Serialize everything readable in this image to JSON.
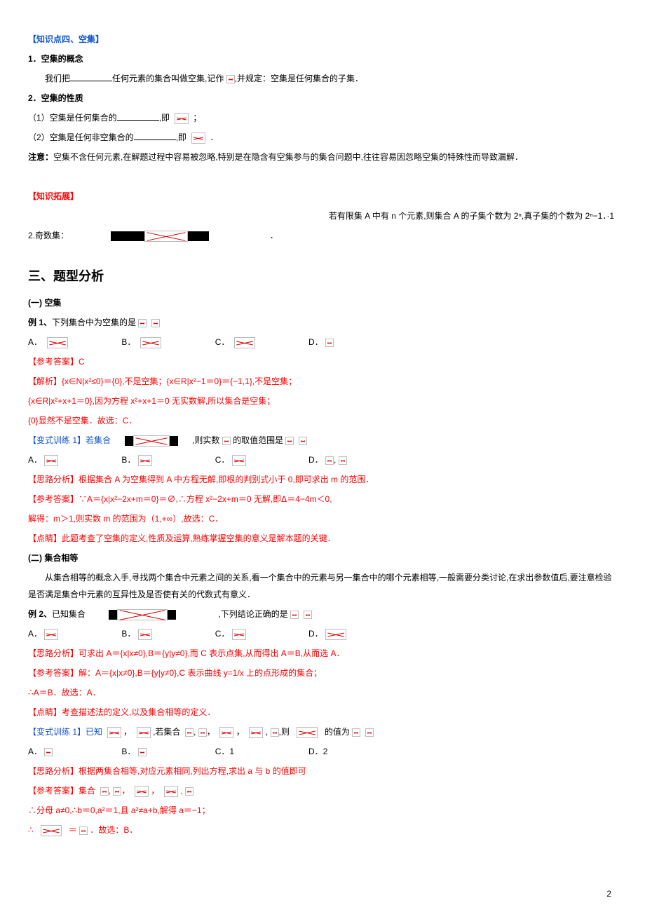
{
  "kp4": {
    "title": "【知识点四、空集】",
    "s1_title": "1．空集的概念",
    "s1_text_pre": "我们把",
    "s1_text_post": "任何元素的集合叫做空集,记作",
    "s1_text_tail": ",并规定：空集是任何集合的子集．",
    "s2_title": "2．空集的性质",
    "s2_p1_pre": "（1）空集是任何集合的",
    "s2_p1_mid": ",即",
    "s2_p1_tail": "；",
    "s2_p2_pre": "（2）空集是任何非空集合的",
    "s2_p2_mid": ",即",
    "s2_p2_tail": "．",
    "note_label": "注意：",
    "note_text": "空集不含任何元素,在解题过程中容易被忽略,特别是在隐含有空集参与的集合问题中,往往容易因忽略空集的特殊性而导致漏解．"
  },
  "ext": {
    "title": "【知识拓展】",
    "line1": "若有限集 A 中有 n 个元素,则集合 A 的子集个数为 2ⁿ,真子集的个数为 2ⁿ−1．·1",
    "line2_pre": "2.奇数集：",
    "line2_tail": "．"
  },
  "sec3": {
    "title": "三、题型分析",
    "p1_title": "(一) 空集",
    "ex1_label": "例 1、",
    "ex1_text": "下列集合中为空集的是",
    "ex1_A": "A．",
    "ex1_B": "B．",
    "ex1_C": "C．",
    "ex1_D": "D．",
    "ans1_h": "【参考答案】C",
    "ans1_l1": "【解析】{x∈N|x²≤0}＝{0},不是空集；{x∈R|x²−1＝0}＝{−1,1},不是空集；",
    "ans1_l2": "{x∈R|x²+x+1＝0},因为方程 x²+x+1＝0 无实数解,所以集合是空集；",
    "ans1_l3": "{0}显然不是空集．故选：C．",
    "var1_pre": "【变式训练 1】若集合",
    "var1_mid": ",则实数",
    "var1_post": "的取值范围是",
    "var1_A": "A．",
    "var1_B": "B．",
    "var1_C": "C．",
    "var1_D": "D．",
    "var1_d_tail": ",",
    "sil1": "【思路分析】根据集合 A 为空集得到 A 中方程无解,即根的判别式小于 0,即可求出 m 的范围．",
    "ref1": "【参考答案】∵A＝{x|x²−2x+m＝0}＝∅,∴方程 x²−2x+m＝0 无解,即Δ＝4−4m＜0,",
    "ref1b": "解得：m＞1,则实数 m 的范围为（1,+∞）,故选：C．",
    "ds1": "【点睛】此题考查了空集的定义,性质及运算,熟练掌握空集的意义是解本题的关键．",
    "p2_title": "(二) 集合相等",
    "p2_intro": "从集合相等的概念入手,寻找两个集合中元素之间的关系,看一个集合中的元素与另一集合中的哪个元素相等,一般需要分类讨论,在求出参数值后,要注意检验是否满足集合中元素的互异性及是否使有关的代数式有意义．",
    "ex2_label": "例 2、",
    "ex2_text": "已知集合",
    "ex2_mid": ",下列结论正确的是",
    "ex2_A": "A．",
    "ex2_B": "B．",
    "ex2_C": "C．",
    "ex2_D": "D．",
    "sil2": "【思路分析】可求出 A＝{x|x≠0},B＝{y|y≠0},而 C 表示点集,从而得出 A＝B,从而选 A．",
    "ref2a": "【参考答案】解：A＝{x|x≠0},B＝{y|y≠0},C 表示曲线 y=1/x 上的点形成的集合；",
    "ref2b": "∴A＝B．故选：A．",
    "ds2": "【点睛】考查描述法的定义,以及集合相等的定义．",
    "var2_pre": "【变式训练 1】已知",
    "var2_c1": "，",
    "var2_c2": ",若集合",
    "var2_c3": ",",
    "var2_c4": "，",
    "var2_c5": "，",
    "var2_c6": ",",
    "var2_c7": ",则",
    "var2_post": "的值为",
    "var2_A": "A．",
    "var2_B": "B．",
    "var2_C": "C．1",
    "var2_D": "D．2",
    "sil3": "【思路分析】根据两集合相等,对应元素相同,列出方程,求出 a 与 b 的值即可",
    "ref3a_pre": "【参考答案】集合",
    "ref3a_mid1": ",",
    "ref3a_mid2": "，",
    "ref3a_mid3": "，",
    "ref3a_mid4": ",",
    "ref3b": "∴分母 a≠0,∴b＝0,a²＝1,且 a²≠a+b,解得 a＝−1；",
    "ref3c_pre": "∴",
    "ref3c_mid": "＝",
    "ref3c_post": "．故选：B．"
  },
  "page": "2"
}
